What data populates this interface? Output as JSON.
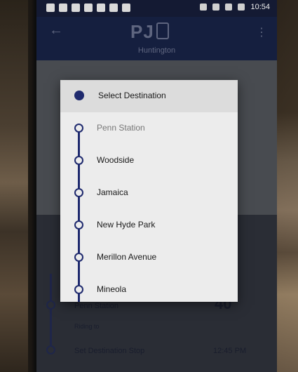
{
  "status_bar": {
    "time": "10:54"
  },
  "app_bar": {
    "logo": "PJ",
    "subtitle": "Huntington",
    "back_icon": "arrow-left-icon",
    "menu_icon": "more-vertical-icon"
  },
  "dialog": {
    "header": "Select Destination",
    "stops": [
      {
        "label": "Penn Station",
        "current": true
      },
      {
        "label": "Woodside",
        "current": false
      },
      {
        "label": "Jamaica",
        "current": false
      },
      {
        "label": "New Hyde Park",
        "current": false
      },
      {
        "label": "Merillon Avenue",
        "current": false
      },
      {
        "label": "Mineola",
        "current": false
      }
    ]
  },
  "background": {
    "origin_stop": "Penn Station",
    "riding_to": "Riding to",
    "destination_label": "Set Destination Stop",
    "destination_time": "12:45 PM",
    "minutes": "40"
  },
  "colors": {
    "accent": "#1f2a6e",
    "app_bar": "#1d2a56"
  }
}
